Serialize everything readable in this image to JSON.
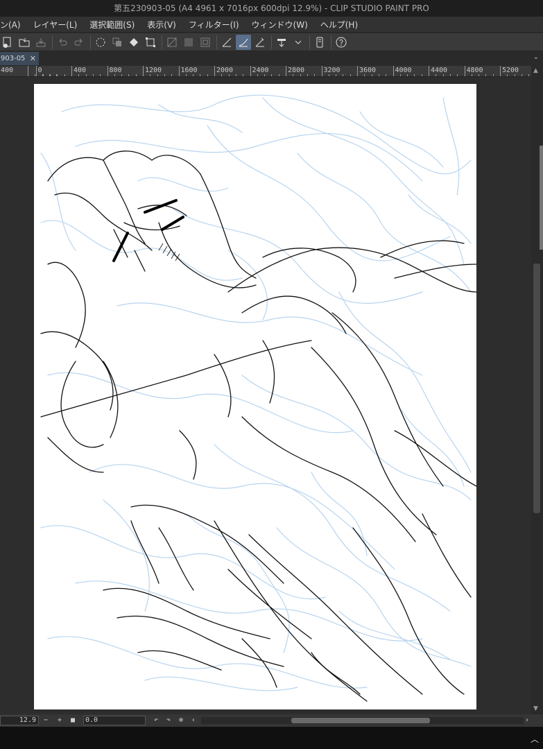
{
  "window": {
    "title": "第五230903-05 (A4 4961 x 7016px 600dpi 12.9%)  - CLIP STUDIO PAINT PRO"
  },
  "menu": [
    "ン(A)",
    "レイヤー(L)",
    "選択範囲(S)",
    "表示(V)",
    "フィルター(I)",
    "ウィンドウ(W)",
    "ヘルプ(H)"
  ],
  "toolbar": {
    "icons": [
      "new-file-icon",
      "open-folder-icon",
      "save-icon",
      "undo-icon",
      "redo-icon",
      "clear-selection-icon",
      "fill-icon",
      "transform-icon",
      "layer-options-icon",
      "stabilizer-icon",
      "pen-pressure-icon",
      "ruler-icon",
      "snap-icon",
      "device-icon",
      "help-icon"
    ]
  },
  "tab": {
    "label": "903-05",
    "close": "✕"
  },
  "ruler": {
    "labels": [
      "400",
      "0",
      "400",
      "800",
      "1200",
      "1600",
      "2000",
      "2400",
      "2800",
      "3200",
      "3600",
      "4000",
      "4400",
      "4800",
      "5200"
    ]
  },
  "status": {
    "zoom": "12.9",
    "minus": "−",
    "plus": "+",
    "angle": "0.0"
  },
  "colors": {
    "sketch_blue": "#b8d4ee",
    "line_black": "#111111",
    "canvas_bg": "#ffffff",
    "workspace_bg": "#2d2d2d"
  }
}
